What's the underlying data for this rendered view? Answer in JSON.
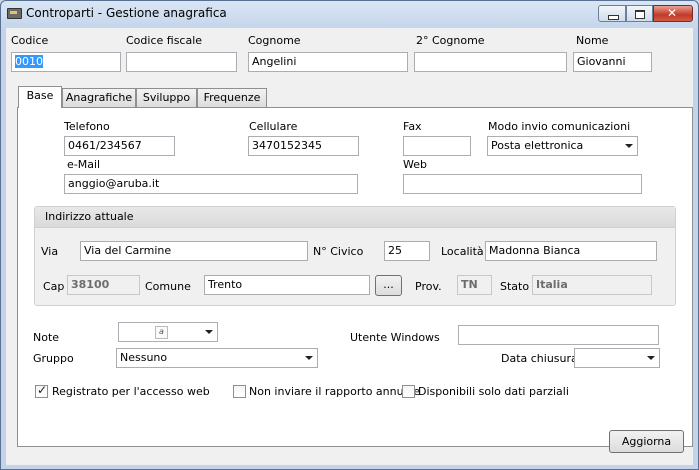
{
  "window": {
    "title": "Controparti - Gestione anagrafica"
  },
  "header": {
    "codice": {
      "label": "Codice",
      "value": "0010"
    },
    "codice_fiscale": {
      "label": "Codice fiscale",
      "value": ""
    },
    "cognome": {
      "label": "Cognome",
      "value": "Angelini"
    },
    "secondo_cognome": {
      "label": "2° Cognome",
      "value": ""
    },
    "nome": {
      "label": "Nome",
      "value": "Giovanni"
    }
  },
  "tabs": [
    {
      "label": "Base"
    },
    {
      "label": "Anagrafiche"
    },
    {
      "label": "Sviluppo"
    },
    {
      "label": "Frequenze"
    }
  ],
  "base": {
    "telefono": {
      "label": "Telefono",
      "value": "0461/234567"
    },
    "cellulare": {
      "label": "Cellulare",
      "value": "3470152345"
    },
    "fax": {
      "label": "Fax",
      "value": ""
    },
    "modo_invio": {
      "label": "Modo invio comunicazioni",
      "value": "Posta elettronica"
    },
    "email": {
      "label": "e-Mail",
      "value": "anggio@aruba.it"
    },
    "web": {
      "label": "Web",
      "value": ""
    }
  },
  "indirizzo": {
    "title": "Indirizzo attuale",
    "via": {
      "label": "Via",
      "value": "Via del Carmine"
    },
    "civico": {
      "label": "N° Civico",
      "value": "25"
    },
    "localita": {
      "label": "Località",
      "value": "Madonna Bianca"
    },
    "cap": {
      "label": "Cap",
      "value": "38100"
    },
    "comune": {
      "label": "Comune",
      "value": "Trento"
    },
    "browse_label": "...",
    "prov": {
      "label": "Prov.",
      "value": "TN"
    },
    "stato": {
      "label": "Stato",
      "value": "Italia"
    }
  },
  "extra": {
    "note": {
      "label": "Note",
      "icon_text": "a"
    },
    "utente_windows": {
      "label": "Utente Windows",
      "value": ""
    },
    "gruppo": {
      "label": "Gruppo",
      "value": "Nessuno"
    },
    "data_chiusura": {
      "label": "Data chiusura",
      "value": ""
    }
  },
  "checkboxes": [
    {
      "label": "Registrato per l'accesso web",
      "checked": true
    },
    {
      "label": "Non inviare il rapporto annuale",
      "checked": false
    },
    {
      "label": "Disponibili solo dati parziali",
      "checked": false
    }
  ],
  "footer": {
    "update_label": "Aggiorna"
  }
}
